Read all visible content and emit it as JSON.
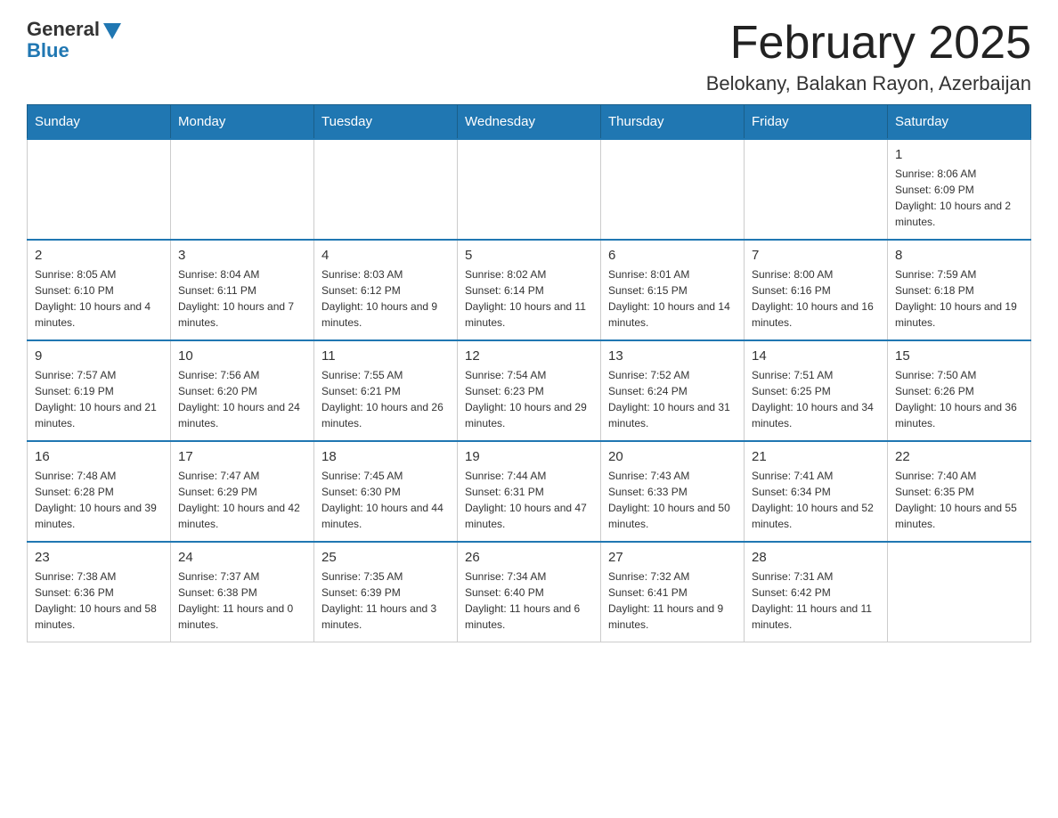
{
  "header": {
    "logo_general": "General",
    "logo_blue": "Blue",
    "month_title": "February 2025",
    "location": "Belokany, Balakan Rayon, Azerbaijan"
  },
  "days_of_week": [
    "Sunday",
    "Monday",
    "Tuesday",
    "Wednesday",
    "Thursday",
    "Friday",
    "Saturday"
  ],
  "weeks": [
    [
      {
        "day": "",
        "info": ""
      },
      {
        "day": "",
        "info": ""
      },
      {
        "day": "",
        "info": ""
      },
      {
        "day": "",
        "info": ""
      },
      {
        "day": "",
        "info": ""
      },
      {
        "day": "",
        "info": ""
      },
      {
        "day": "1",
        "info": "Sunrise: 8:06 AM\nSunset: 6:09 PM\nDaylight: 10 hours and 2 minutes."
      }
    ],
    [
      {
        "day": "2",
        "info": "Sunrise: 8:05 AM\nSunset: 6:10 PM\nDaylight: 10 hours and 4 minutes."
      },
      {
        "day": "3",
        "info": "Sunrise: 8:04 AM\nSunset: 6:11 PM\nDaylight: 10 hours and 7 minutes."
      },
      {
        "day": "4",
        "info": "Sunrise: 8:03 AM\nSunset: 6:12 PM\nDaylight: 10 hours and 9 minutes."
      },
      {
        "day": "5",
        "info": "Sunrise: 8:02 AM\nSunset: 6:14 PM\nDaylight: 10 hours and 11 minutes."
      },
      {
        "day": "6",
        "info": "Sunrise: 8:01 AM\nSunset: 6:15 PM\nDaylight: 10 hours and 14 minutes."
      },
      {
        "day": "7",
        "info": "Sunrise: 8:00 AM\nSunset: 6:16 PM\nDaylight: 10 hours and 16 minutes."
      },
      {
        "day": "8",
        "info": "Sunrise: 7:59 AM\nSunset: 6:18 PM\nDaylight: 10 hours and 19 minutes."
      }
    ],
    [
      {
        "day": "9",
        "info": "Sunrise: 7:57 AM\nSunset: 6:19 PM\nDaylight: 10 hours and 21 minutes."
      },
      {
        "day": "10",
        "info": "Sunrise: 7:56 AM\nSunset: 6:20 PM\nDaylight: 10 hours and 24 minutes."
      },
      {
        "day": "11",
        "info": "Sunrise: 7:55 AM\nSunset: 6:21 PM\nDaylight: 10 hours and 26 minutes."
      },
      {
        "day": "12",
        "info": "Sunrise: 7:54 AM\nSunset: 6:23 PM\nDaylight: 10 hours and 29 minutes."
      },
      {
        "day": "13",
        "info": "Sunrise: 7:52 AM\nSunset: 6:24 PM\nDaylight: 10 hours and 31 minutes."
      },
      {
        "day": "14",
        "info": "Sunrise: 7:51 AM\nSunset: 6:25 PM\nDaylight: 10 hours and 34 minutes."
      },
      {
        "day": "15",
        "info": "Sunrise: 7:50 AM\nSunset: 6:26 PM\nDaylight: 10 hours and 36 minutes."
      }
    ],
    [
      {
        "day": "16",
        "info": "Sunrise: 7:48 AM\nSunset: 6:28 PM\nDaylight: 10 hours and 39 minutes."
      },
      {
        "day": "17",
        "info": "Sunrise: 7:47 AM\nSunset: 6:29 PM\nDaylight: 10 hours and 42 minutes."
      },
      {
        "day": "18",
        "info": "Sunrise: 7:45 AM\nSunset: 6:30 PM\nDaylight: 10 hours and 44 minutes."
      },
      {
        "day": "19",
        "info": "Sunrise: 7:44 AM\nSunset: 6:31 PM\nDaylight: 10 hours and 47 minutes."
      },
      {
        "day": "20",
        "info": "Sunrise: 7:43 AM\nSunset: 6:33 PM\nDaylight: 10 hours and 50 minutes."
      },
      {
        "day": "21",
        "info": "Sunrise: 7:41 AM\nSunset: 6:34 PM\nDaylight: 10 hours and 52 minutes."
      },
      {
        "day": "22",
        "info": "Sunrise: 7:40 AM\nSunset: 6:35 PM\nDaylight: 10 hours and 55 minutes."
      }
    ],
    [
      {
        "day": "23",
        "info": "Sunrise: 7:38 AM\nSunset: 6:36 PM\nDaylight: 10 hours and 58 minutes."
      },
      {
        "day": "24",
        "info": "Sunrise: 7:37 AM\nSunset: 6:38 PM\nDaylight: 11 hours and 0 minutes."
      },
      {
        "day": "25",
        "info": "Sunrise: 7:35 AM\nSunset: 6:39 PM\nDaylight: 11 hours and 3 minutes."
      },
      {
        "day": "26",
        "info": "Sunrise: 7:34 AM\nSunset: 6:40 PM\nDaylight: 11 hours and 6 minutes."
      },
      {
        "day": "27",
        "info": "Sunrise: 7:32 AM\nSunset: 6:41 PM\nDaylight: 11 hours and 9 minutes."
      },
      {
        "day": "28",
        "info": "Sunrise: 7:31 AM\nSunset: 6:42 PM\nDaylight: 11 hours and 11 minutes."
      },
      {
        "day": "",
        "info": ""
      }
    ]
  ]
}
